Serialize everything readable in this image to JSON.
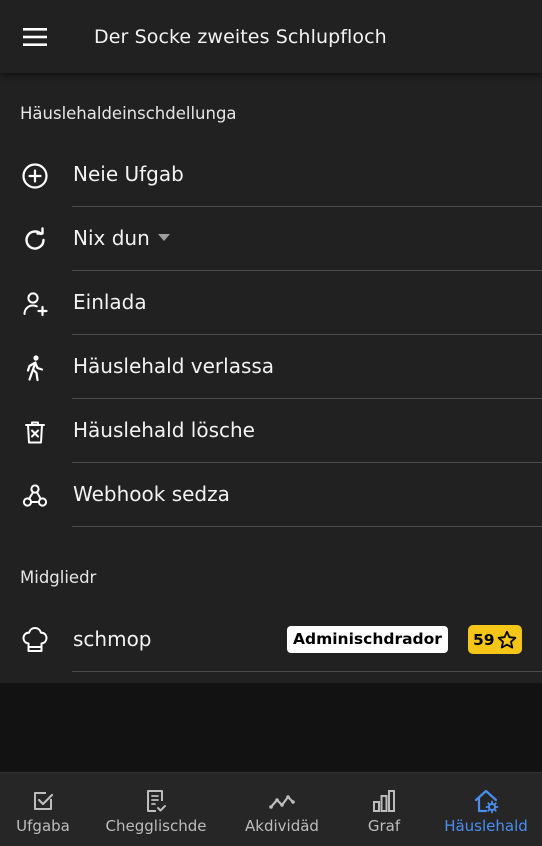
{
  "appbar": {
    "title": "Der Socke zweites Schlupfloch",
    "menu_icon": "menu-icon"
  },
  "settings": {
    "header": "Häuslehaldeinschdellunga",
    "items": [
      {
        "label": "Neie Ufgab",
        "icon": "add-circle-icon"
      },
      {
        "label": "Nix dun",
        "icon": "refresh-icon",
        "has_dropdown": true
      },
      {
        "label": "Einlada",
        "icon": "person-add-icon"
      },
      {
        "label": "Häuslehald verlassa",
        "icon": "walk-icon"
      },
      {
        "label": "Häuslehald lösche",
        "icon": "trash-icon"
      },
      {
        "label": "Webhook sedza",
        "icon": "webhook-icon"
      }
    ]
  },
  "members": {
    "header": "Midgliedr",
    "items": [
      {
        "name": "schmop",
        "icon": "chef-hat-icon",
        "role": "Adminischdrador",
        "points": "59",
        "points_icon": "star-icon"
      }
    ]
  },
  "bottom_nav": {
    "items": [
      {
        "label": "Ufgaba",
        "icon": "task-check-icon",
        "active": false
      },
      {
        "label": "Chegglischde",
        "icon": "checklist-icon",
        "active": false
      },
      {
        "label": "Akdividäd",
        "icon": "activity-icon",
        "active": false
      },
      {
        "label": "Graf",
        "icon": "bar-chart-icon",
        "active": false
      },
      {
        "label": "Häuslehald",
        "icon": "house-settings-icon",
        "active": true
      }
    ]
  },
  "colors": {
    "accent": "#4a8ef0",
    "points_badge": "#f5c518",
    "surface": "#212121",
    "background": "#121212"
  }
}
